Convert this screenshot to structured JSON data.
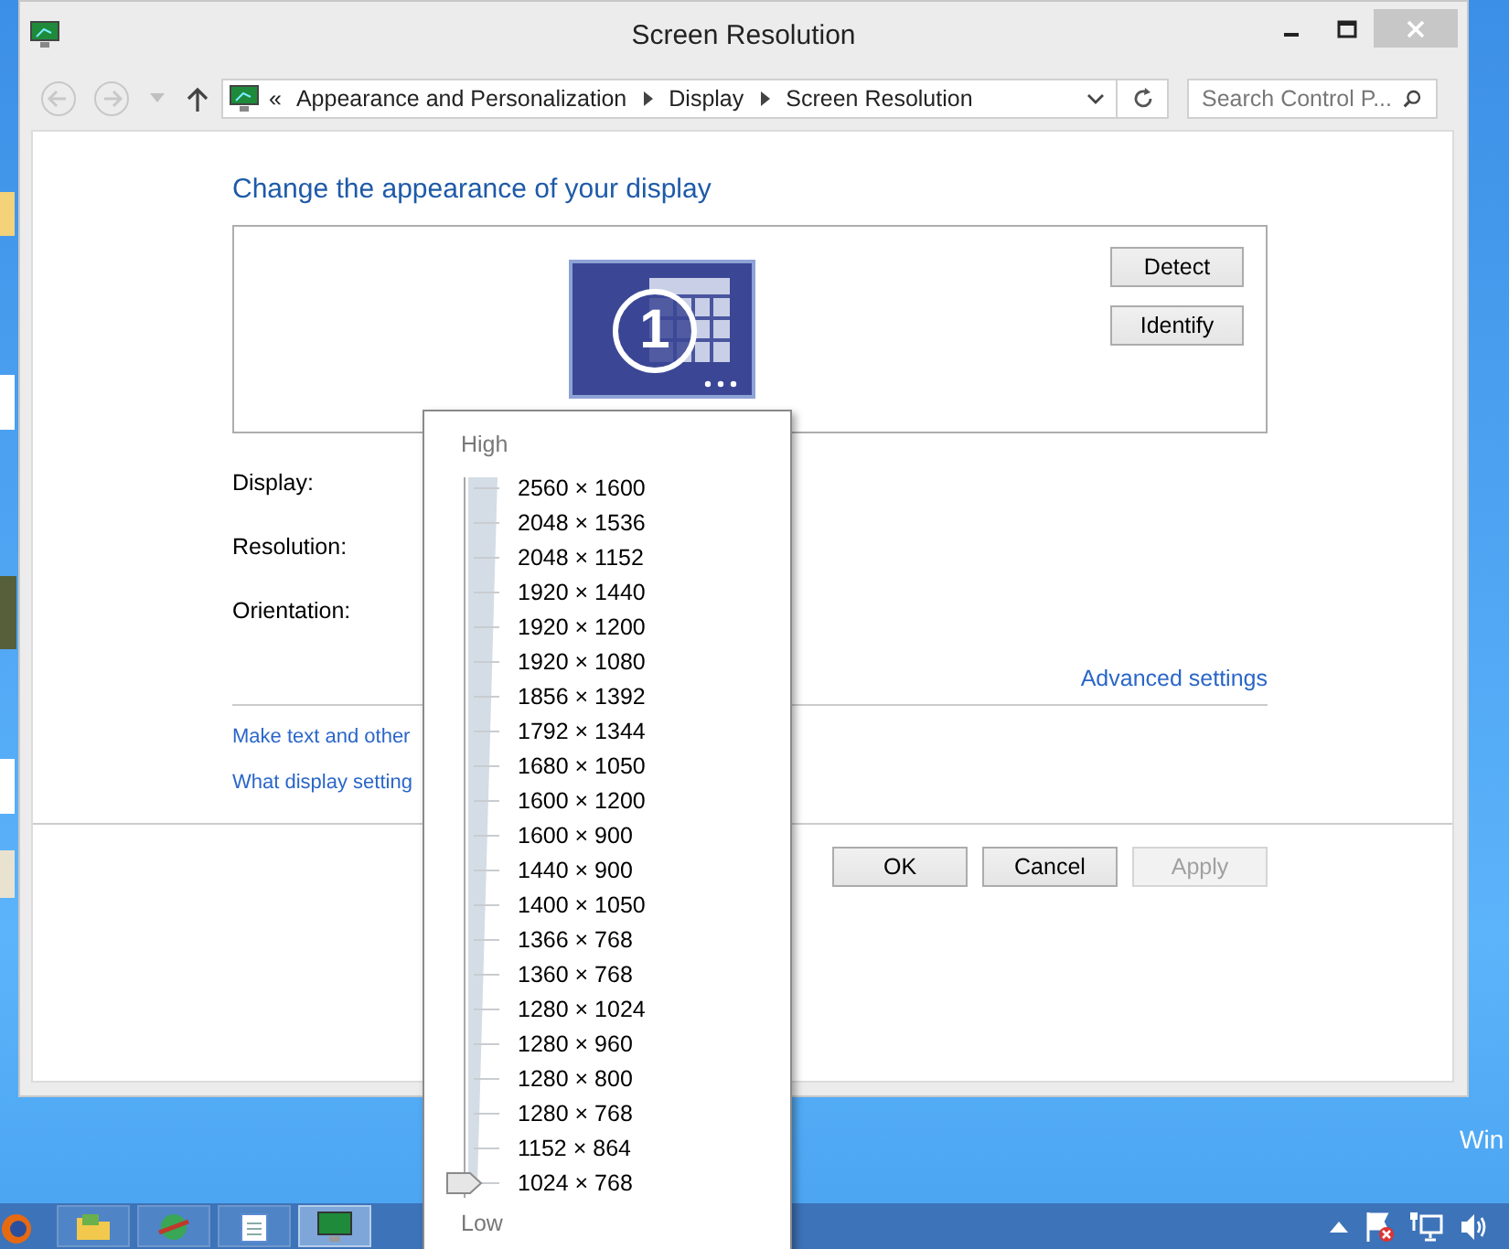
{
  "window": {
    "title": "Screen Resolution"
  },
  "address_bar": {
    "overflow": "«",
    "breadcrumb": [
      "Appearance and Personalization",
      "Display",
      "Screen Resolution"
    ]
  },
  "search": {
    "placeholder": "Search Control P..."
  },
  "heading": "Change the appearance of your display",
  "monitor": {
    "number": "1"
  },
  "monitor_buttons": [
    "Detect",
    "Identify"
  ],
  "fields": [
    {
      "label": "Display:"
    },
    {
      "label": "Resolution:"
    },
    {
      "label": "Orientation:"
    }
  ],
  "advanced_link": "Advanced settings",
  "links": [
    "Make text and other",
    "What display setting"
  ],
  "buttons": [
    {
      "label": "OK",
      "disabled": false
    },
    {
      "label": "Cancel",
      "disabled": false
    },
    {
      "label": "Apply",
      "disabled": true
    }
  ],
  "resolution_popup": {
    "high_label": "High",
    "low_label": "Low",
    "level": 0,
    "options": [
      "2560 × 1600",
      "2048 × 1536",
      "2048 × 1152",
      "1920 × 1440",
      "1920 × 1200",
      "1920 × 1080",
      "1856 × 1392",
      "1792 × 1344",
      "1680 × 1050",
      "1600 × 1200",
      "1600 × 900",
      "1440 × 900",
      "1400 × 1050",
      "1366 × 768",
      "1360 × 768",
      "1280 × 1024",
      "1280 × 960",
      "1280 × 800",
      "1280 × 768",
      "1152 × 864",
      "1024 × 768"
    ]
  },
  "desktop_text": "Win",
  "taskbar": {
    "apps": [
      {
        "kind": "folder",
        "selected": false
      },
      {
        "kind": "globe",
        "selected": false
      },
      {
        "kind": "notepad",
        "selected": false
      },
      {
        "kind": "display",
        "selected": true
      }
    ]
  }
}
